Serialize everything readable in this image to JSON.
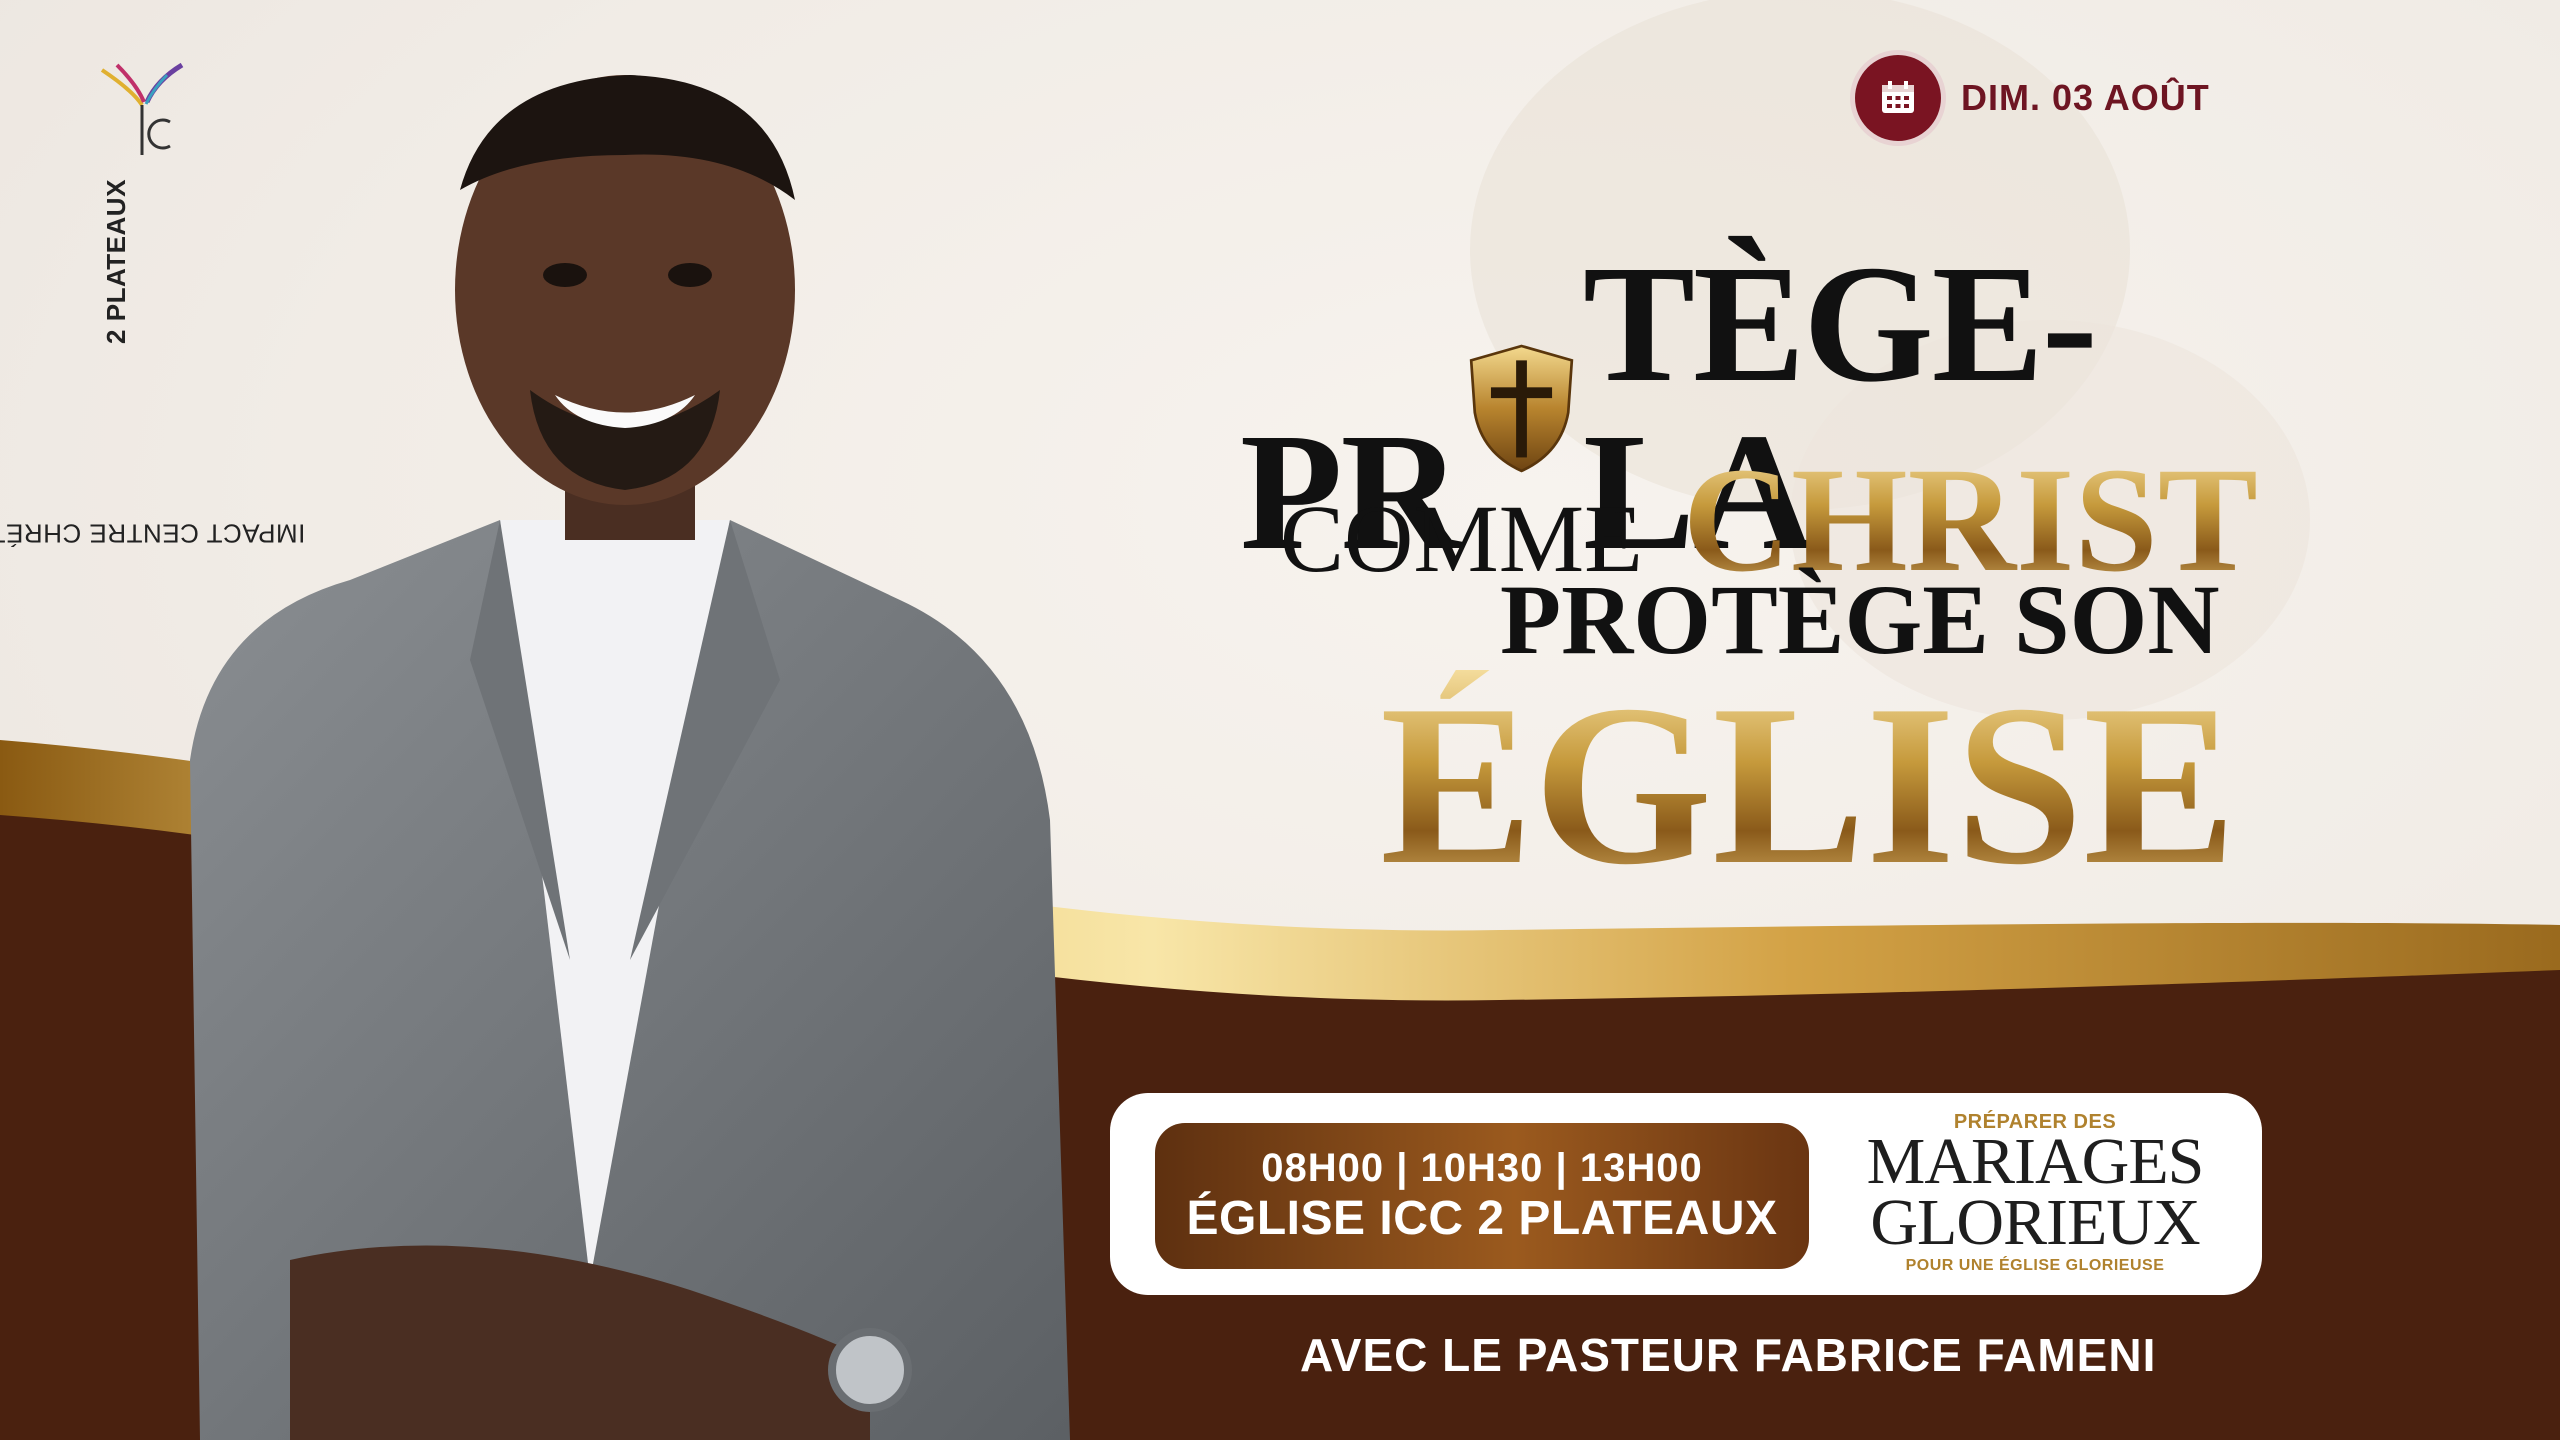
{
  "brand": {
    "logo_text": "ICC",
    "vertical_prefix": "IMPACT CENTRE CHRÉTIEN - ",
    "vertical_strong": "2 PLATEAUX"
  },
  "date_badge": {
    "icon": "calendar-icon",
    "label": "DIM. 03 AOÛT"
  },
  "headline": {
    "line1_pre": "PR",
    "line1_icon": "shield-cross-icon",
    "line1_post": "TÈGE-LA",
    "line2_a": "COMME",
    "line2_b": "CHRIST",
    "line3": "PROTÈGE SON",
    "line4": "ÉGLISE"
  },
  "schedule": {
    "times": "08H00 | 10H30 | 13H00",
    "venue": "ÉGLISE ICC 2 PLATEAUX"
  },
  "series": {
    "top": "PRÉPARER DES",
    "line1": "MARIAGES",
    "line2": "GLORIEUX",
    "bottom": "POUR UNE ÉGLISE GLORIEUSE"
  },
  "speaker": "AVEC LE PASTEUR FABRICE FAMENI",
  "colors": {
    "brown": "#4a210f",
    "gold": "#c99a3c",
    "maroon": "#7a1422",
    "cream": "#f4f1ed"
  }
}
